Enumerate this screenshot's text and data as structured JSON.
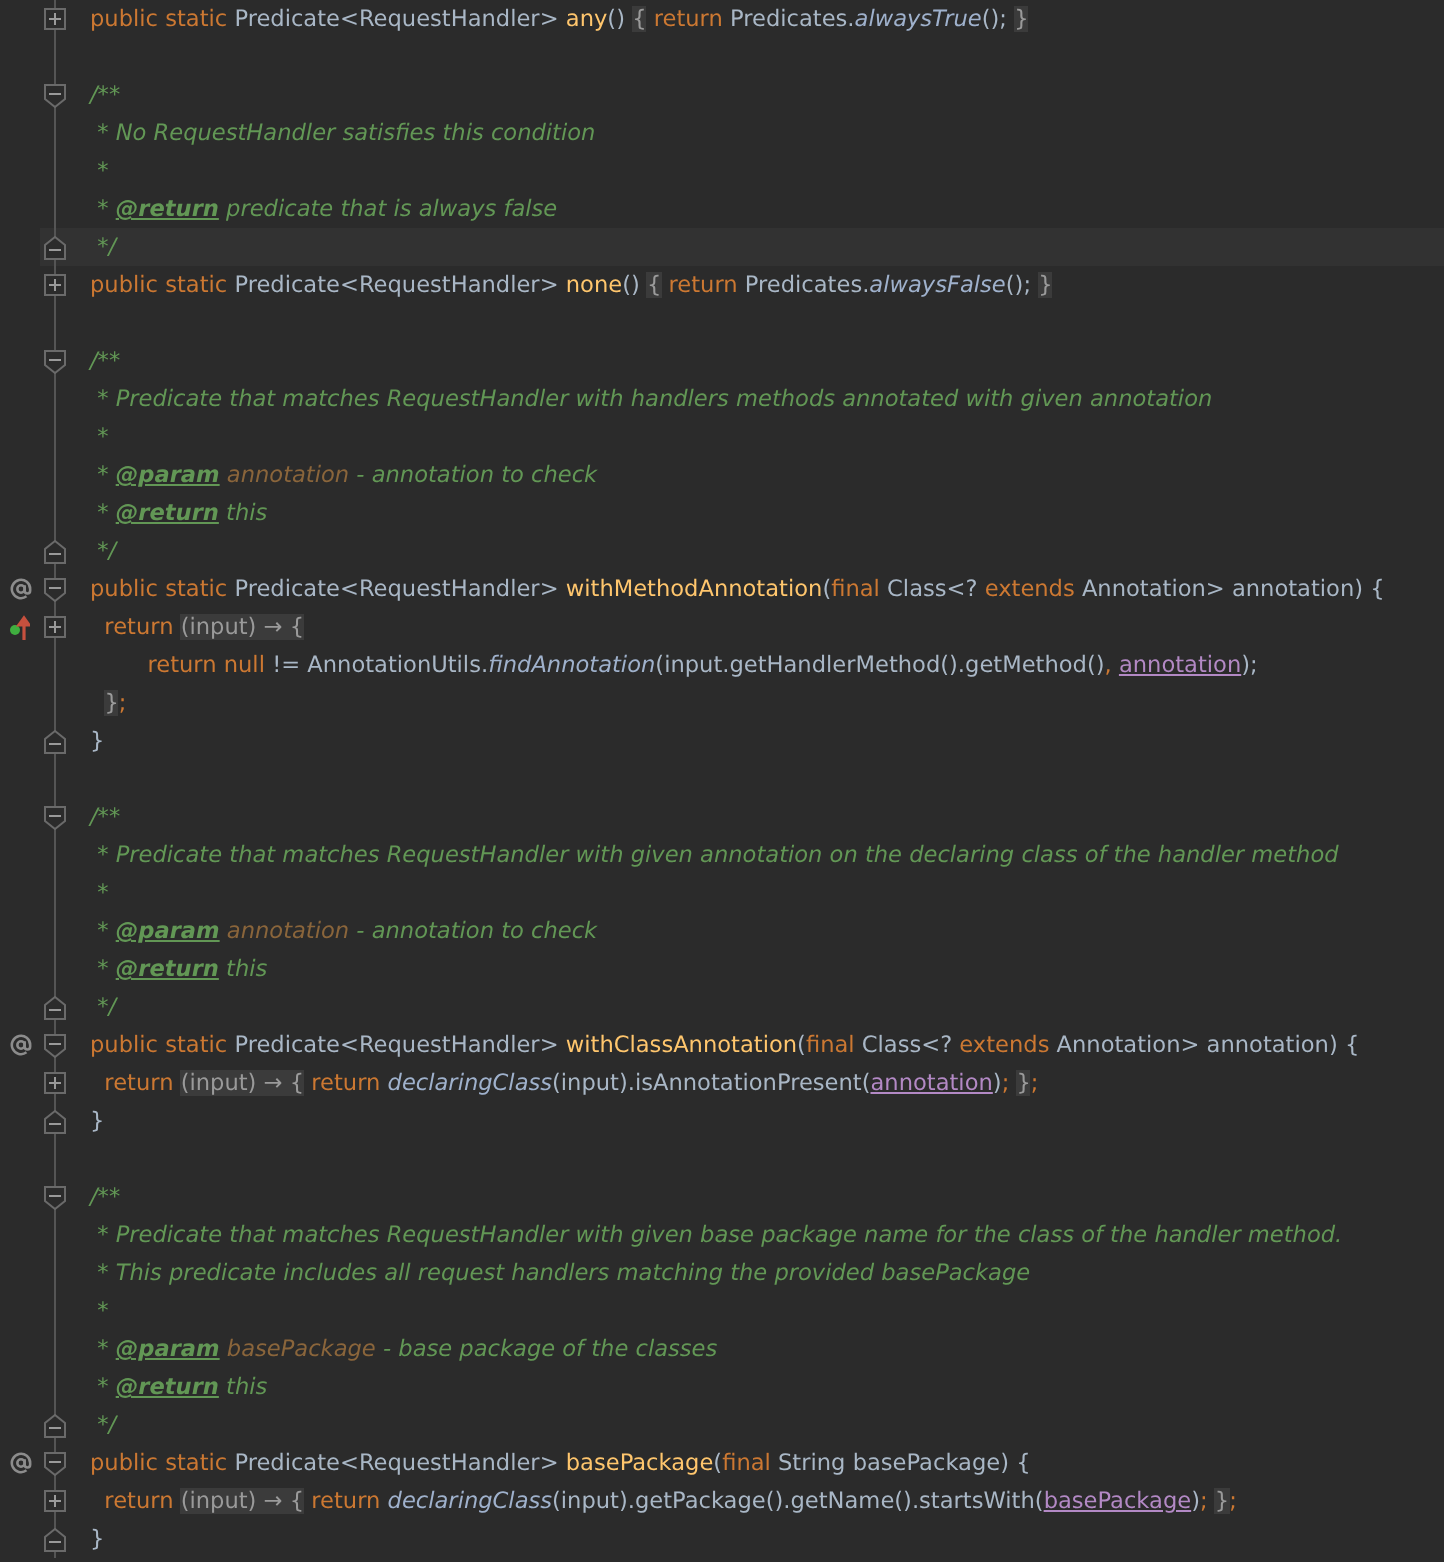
{
  "lines": [
    {
      "fold": {
        "kind": "collapsed"
      },
      "tokens": [
        {
          "kind": "kw",
          "text": "public static "
        },
        {
          "kind": "text",
          "text": "Predicate<RequestHandler> "
        },
        {
          "kind": "decl",
          "text": "any"
        },
        {
          "kind": "text",
          "text": "() "
        },
        {
          "kind": "fold",
          "text": "{"
        },
        {
          "kind": "kw",
          "text": " return "
        },
        {
          "kind": "text",
          "text": "Predicates."
        },
        {
          "kind": "static",
          "text": "alwaysTrue"
        },
        {
          "kind": "text",
          "text": "();"
        },
        {
          "kind": "fold",
          "text": " }"
        }
      ]
    },
    {
      "kind": "blank"
    },
    {
      "fold": {
        "kind": "start"
      },
      "tokens": [
        {
          "kind": "comment",
          "text": "/**"
        }
      ]
    },
    {
      "tokens": [
        {
          "kind": "comment",
          "text": " * No RequestHandler satisfies this condition"
        }
      ]
    },
    {
      "tokens": [
        {
          "kind": "comment",
          "text": " *"
        }
      ]
    },
    {
      "tokens": [
        {
          "kind": "comment",
          "text": " * "
        },
        {
          "kind": "tag",
          "text": "@return"
        },
        {
          "kind": "comment",
          "text": " predicate that is always false"
        }
      ]
    },
    {
      "fold": {
        "kind": "end"
      },
      "current": true,
      "tokens": [
        {
          "kind": "comment",
          "text": " */"
        }
      ]
    },
    {
      "fold": {
        "kind": "collapsed"
      },
      "tokens": [
        {
          "kind": "kw",
          "text": "public static "
        },
        {
          "kind": "text",
          "text": "Predicate<RequestHandler> "
        },
        {
          "kind": "decl",
          "text": "none"
        },
        {
          "kind": "text",
          "text": "() "
        },
        {
          "kind": "fold",
          "text": "{"
        },
        {
          "kind": "kw",
          "text": " return "
        },
        {
          "kind": "text",
          "text": "Predicates."
        },
        {
          "kind": "static",
          "text": "alwaysFalse"
        },
        {
          "kind": "text",
          "text": "();"
        },
        {
          "kind": "fold",
          "text": " }"
        }
      ]
    },
    {
      "kind": "blank"
    },
    {
      "fold": {
        "kind": "start"
      },
      "tokens": [
        {
          "kind": "comment",
          "text": "/**"
        }
      ]
    },
    {
      "tokens": [
        {
          "kind": "comment",
          "text": " * Predicate that matches RequestHandler with handlers methods annotated with given annotation"
        }
      ]
    },
    {
      "tokens": [
        {
          "kind": "comment",
          "text": " *"
        }
      ]
    },
    {
      "tokens": [
        {
          "kind": "comment",
          "text": " * "
        },
        {
          "kind": "tag",
          "text": "@param"
        },
        {
          "kind": "docparam",
          "text": " annotation"
        },
        {
          "kind": "comment",
          "text": " - annotation to check"
        }
      ]
    },
    {
      "tokens": [
        {
          "kind": "comment",
          "text": " * "
        },
        {
          "kind": "tag",
          "text": "@return"
        },
        {
          "kind": "comment",
          "text": " this"
        }
      ]
    },
    {
      "fold": {
        "kind": "end"
      },
      "tokens": [
        {
          "kind": "comment",
          "text": " */"
        }
      ]
    },
    {
      "fold": {
        "kind": "start"
      },
      "marker": {
        "kind": "at"
      },
      "tokens": [
        {
          "kind": "kw",
          "text": "public static "
        },
        {
          "kind": "text",
          "text": "Predicate<RequestHandler> "
        },
        {
          "kind": "decl",
          "text": "withMethodAnnotation"
        },
        {
          "kind": "text",
          "text": "("
        },
        {
          "kind": "kw",
          "text": "final "
        },
        {
          "kind": "text",
          "text": "Class<? "
        },
        {
          "kind": "kw",
          "text": "extends "
        },
        {
          "kind": "text",
          "text": "Annotation> annotation) {"
        }
      ]
    },
    {
      "fold": {
        "kind": "collapsed"
      },
      "marker": {
        "kind": "arrows"
      },
      "tokens": [
        {
          "kind": "kw",
          "text": "  return "
        },
        {
          "kind": "fold",
          "text": "(input) → {"
        }
      ]
    },
    {
      "tokens": [
        {
          "kind": "kw",
          "text": "        return null "
        },
        {
          "kind": "text",
          "text": "!= AnnotationUtils."
        },
        {
          "kind": "static",
          "text": "findAnnotation"
        },
        {
          "kind": "text",
          "text": "(input.getHandlerMethod().getMethod()"
        },
        {
          "kind": "kw",
          "text": ", "
        },
        {
          "kind": "param",
          "text": "annotation"
        },
        {
          "kind": "text",
          "text": ");"
        }
      ]
    },
    {
      "tokens": [
        {
          "kind": "fold",
          "text": "  }"
        },
        {
          "kind": "kw",
          "text": ";"
        }
      ]
    },
    {
      "fold": {
        "kind": "end"
      },
      "tokens": [
        {
          "kind": "text",
          "text": "}"
        }
      ]
    },
    {
      "kind": "blank"
    },
    {
      "fold": {
        "kind": "start"
      },
      "tokens": [
        {
          "kind": "comment",
          "text": "/**"
        }
      ]
    },
    {
      "tokens": [
        {
          "kind": "comment",
          "text": " * Predicate that matches RequestHandler with given annotation on the declaring class of the handler method"
        }
      ]
    },
    {
      "tokens": [
        {
          "kind": "comment",
          "text": " *"
        }
      ]
    },
    {
      "tokens": [
        {
          "kind": "comment",
          "text": " * "
        },
        {
          "kind": "tag",
          "text": "@param"
        },
        {
          "kind": "docparam",
          "text": " annotation"
        },
        {
          "kind": "comment",
          "text": " - annotation to check"
        }
      ]
    },
    {
      "tokens": [
        {
          "kind": "comment",
          "text": " * "
        },
        {
          "kind": "tag",
          "text": "@return"
        },
        {
          "kind": "comment",
          "text": " this"
        }
      ]
    },
    {
      "fold": {
        "kind": "end"
      },
      "tokens": [
        {
          "kind": "comment",
          "text": " */"
        }
      ]
    },
    {
      "fold": {
        "kind": "start"
      },
      "marker": {
        "kind": "at"
      },
      "tokens": [
        {
          "kind": "kw",
          "text": "public static "
        },
        {
          "kind": "text",
          "text": "Predicate<RequestHandler> "
        },
        {
          "kind": "decl",
          "text": "withClassAnnotation"
        },
        {
          "kind": "text",
          "text": "("
        },
        {
          "kind": "kw",
          "text": "final "
        },
        {
          "kind": "text",
          "text": "Class<? "
        },
        {
          "kind": "kw",
          "text": "extends "
        },
        {
          "kind": "text",
          "text": "Annotation> annotation) {"
        }
      ]
    },
    {
      "fold": {
        "kind": "collapsed"
      },
      "tokens": [
        {
          "kind": "kw",
          "text": "  return "
        },
        {
          "kind": "fold",
          "text": "(input) → {"
        },
        {
          "kind": "kw",
          "text": " return "
        },
        {
          "kind": "static",
          "text": "declaringClass"
        },
        {
          "kind": "text",
          "text": "(input).isAnnotationPresent("
        },
        {
          "kind": "param",
          "text": "annotation"
        },
        {
          "kind": "text",
          "text": ")"
        },
        {
          "kind": "kw",
          "text": ";"
        },
        {
          "kind": "fold",
          "text": " }"
        },
        {
          "kind": "kw",
          "text": ";"
        }
      ]
    },
    {
      "fold": {
        "kind": "end"
      },
      "tokens": [
        {
          "kind": "text",
          "text": "}"
        }
      ]
    },
    {
      "kind": "blank"
    },
    {
      "fold": {
        "kind": "start"
      },
      "tokens": [
        {
          "kind": "comment",
          "text": "/**"
        }
      ]
    },
    {
      "tokens": [
        {
          "kind": "comment",
          "text": " * Predicate that matches RequestHandler with given base package name for the class of the handler method."
        }
      ]
    },
    {
      "tokens": [
        {
          "kind": "comment",
          "text": " * This predicate includes all request handlers matching the provided basePackage"
        }
      ]
    },
    {
      "tokens": [
        {
          "kind": "comment",
          "text": " *"
        }
      ]
    },
    {
      "tokens": [
        {
          "kind": "comment",
          "text": " * "
        },
        {
          "kind": "tag",
          "text": "@param"
        },
        {
          "kind": "docparam",
          "text": " basePackage"
        },
        {
          "kind": "comment",
          "text": " - base package of the classes"
        }
      ]
    },
    {
      "tokens": [
        {
          "kind": "comment",
          "text": " * "
        },
        {
          "kind": "tag",
          "text": "@return"
        },
        {
          "kind": "comment",
          "text": " this"
        }
      ]
    },
    {
      "fold": {
        "kind": "end"
      },
      "tokens": [
        {
          "kind": "comment",
          "text": " */"
        }
      ]
    },
    {
      "fold": {
        "kind": "start"
      },
      "marker": {
        "kind": "at"
      },
      "tokens": [
        {
          "kind": "kw",
          "text": "public static "
        },
        {
          "kind": "text",
          "text": "Predicate<RequestHandler> "
        },
        {
          "kind": "decl",
          "text": "basePackage"
        },
        {
          "kind": "text",
          "text": "("
        },
        {
          "kind": "kw",
          "text": "final "
        },
        {
          "kind": "text",
          "text": "String basePackage) {"
        }
      ]
    },
    {
      "fold": {
        "kind": "collapsed"
      },
      "tokens": [
        {
          "kind": "kw",
          "text": "  return "
        },
        {
          "kind": "fold",
          "text": "(input) → {"
        },
        {
          "kind": "kw",
          "text": " return "
        },
        {
          "kind": "static",
          "text": "declaringClass"
        },
        {
          "kind": "text",
          "text": "(input).getPackage().getName().startsWith("
        },
        {
          "kind": "param",
          "text": "basePackage"
        },
        {
          "kind": "text",
          "text": ")"
        },
        {
          "kind": "kw",
          "text": ";"
        },
        {
          "kind": "fold",
          "text": " }"
        },
        {
          "kind": "kw",
          "text": ";"
        }
      ]
    },
    {
      "fold": {
        "kind": "end"
      },
      "tokens": [
        {
          "kind": "text",
          "text": "}"
        }
      ]
    }
  ]
}
